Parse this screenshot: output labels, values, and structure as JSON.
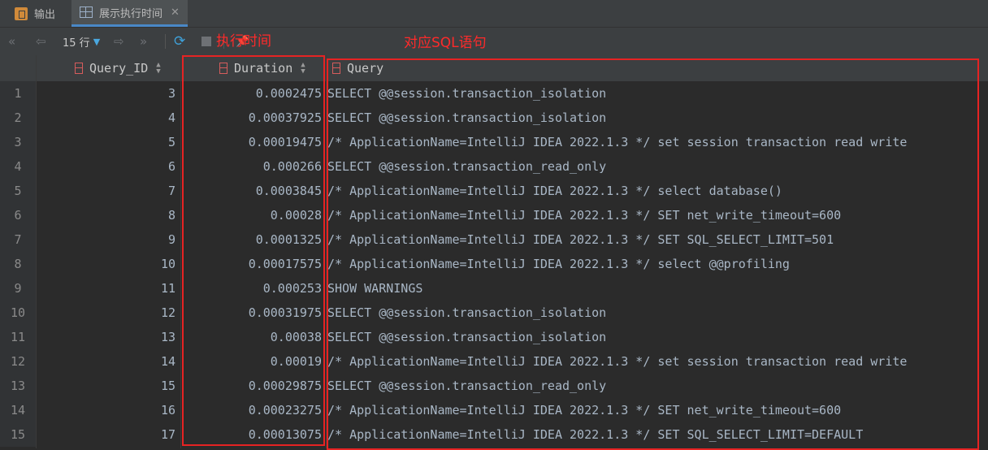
{
  "tabs": [
    {
      "label": "输出",
      "icon": "output-icon"
    },
    {
      "label": "展示执行时间",
      "icon": "table-grid-icon",
      "close": "✕"
    }
  ],
  "toolbar": {
    "rows_label": "15 行",
    "first_icon": "double-left-icon",
    "prev_icon": "arrow-left-icon",
    "next_icon": "arrow-right-icon",
    "last_icon": "double-right-icon",
    "refresh_icon": "refresh-icon",
    "stop_icon": "stop-icon",
    "pin_icon": "pin-icon"
  },
  "annotations": {
    "duration_note": "执行时间",
    "query_note": "对应SQL语句",
    "color": "#ff2a2a"
  },
  "columns": [
    "Query_ID",
    "Duration",
    "Query"
  ],
  "rows": [
    {
      "n": "1",
      "id": "3",
      "dur": "0.0002475",
      "q": "SELECT @@session.transaction_isolation"
    },
    {
      "n": "2",
      "id": "4",
      "dur": "0.00037925",
      "q": "SELECT @@session.transaction_isolation"
    },
    {
      "n": "3",
      "id": "5",
      "dur": "0.00019475",
      "q": "/* ApplicationName=IntelliJ IDEA 2022.1.3 */ set session transaction read write"
    },
    {
      "n": "4",
      "id": "6",
      "dur": "0.000266",
      "q": "SELECT @@session.transaction_read_only"
    },
    {
      "n": "5",
      "id": "7",
      "dur": "0.0003845",
      "q": "/* ApplicationName=IntelliJ IDEA 2022.1.3 */ select database()"
    },
    {
      "n": "6",
      "id": "8",
      "dur": "0.00028",
      "q": "/* ApplicationName=IntelliJ IDEA 2022.1.3 */ SET net_write_timeout=600"
    },
    {
      "n": "7",
      "id": "9",
      "dur": "0.0001325",
      "q": "/* ApplicationName=IntelliJ IDEA 2022.1.3 */ SET SQL_SELECT_LIMIT=501"
    },
    {
      "n": "8",
      "id": "10",
      "dur": "0.00017575",
      "q": "/* ApplicationName=IntelliJ IDEA 2022.1.3 */ select @@profiling"
    },
    {
      "n": "9",
      "id": "11",
      "dur": "0.000253",
      "q": "SHOW WARNINGS"
    },
    {
      "n": "10",
      "id": "12",
      "dur": "0.00031975",
      "q": "SELECT @@session.transaction_isolation"
    },
    {
      "n": "11",
      "id": "13",
      "dur": "0.00038",
      "q": "SELECT @@session.transaction_isolation"
    },
    {
      "n": "12",
      "id": "14",
      "dur": "0.00019",
      "q": "/* ApplicationName=IntelliJ IDEA 2022.1.3 */ set session transaction read write"
    },
    {
      "n": "13",
      "id": "15",
      "dur": "0.00029875",
      "q": "SELECT @@session.transaction_read_only"
    },
    {
      "n": "14",
      "id": "16",
      "dur": "0.00023275",
      "q": "/* ApplicationName=IntelliJ IDEA 2022.1.3 */ SET net_write_timeout=600"
    },
    {
      "n": "15",
      "id": "17",
      "dur": "0.00013075",
      "q": "/* ApplicationName=IntelliJ IDEA 2022.1.3 */ SET SQL_SELECT_LIMIT=DEFAULT"
    }
  ]
}
